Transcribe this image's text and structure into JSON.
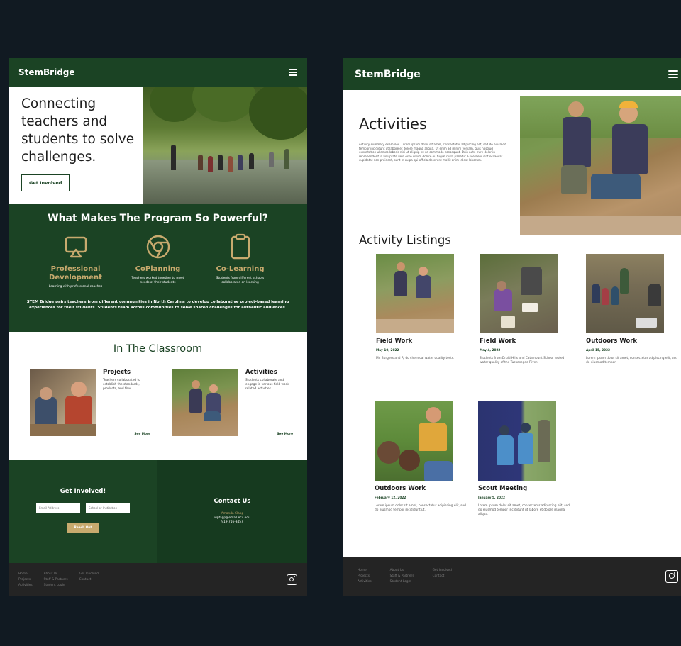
{
  "brand": "StemBridge",
  "home": {
    "hero_title": "Connecting teachers and students to solve challenges.",
    "hero_button": "Get Involved",
    "program_title": "What Makes The Program So Powerful?",
    "features": [
      {
        "name": "Professional Development",
        "desc": "Learning with professional coaches",
        "icon": "presentation-icon"
      },
      {
        "name": "CoPlanning",
        "desc": "Teachers worked together to meet needs of their students",
        "icon": "chrome-circle-icon"
      },
      {
        "name": "Co-Learning",
        "desc": "Students from different schools collaborated on learning",
        "icon": "clipboard-icon"
      }
    ],
    "program_paragraph": "STEM Bridge pairs teachers from different communities in North Carolina to develop collaborative project-based learning experiences for their students. Students team across communities to solve shared challenges for authentic audiences.",
    "classroom_title": "In The Classroom",
    "cards": [
      {
        "title": "Projects",
        "desc": "Teachers collaborated to establish the standards, products, and flow.",
        "more": "See More"
      },
      {
        "title": "Activities",
        "desc": "Students collaborate and engage in various field work related activities.",
        "more": "See More"
      }
    ],
    "get_involved": {
      "title": "Get Involved!",
      "email_placeholder": "Email Address",
      "school_placeholder": "School or Institution",
      "button": "Reach Out"
    },
    "contact": {
      "title": "Contact Us",
      "name": "Amanda Clapp",
      "email": "wpfapp@email.ecu.edu",
      "phone": "919-716-3457"
    }
  },
  "footer": {
    "col1": [
      "Home",
      "Projects",
      "Activities"
    ],
    "col2": [
      "About Us",
      "Staff & Partners",
      "Student Login"
    ],
    "col3": [
      "Get Involved",
      "Contact"
    ]
  },
  "activities": {
    "title": "Activities",
    "summary": "Activity summary examples. Lorem ipsum dolor sit amet, consectetur adipiscing elit, sed do eiusmod tempor incididunt ut labore et dolore magna aliqua. Ut enim ad minim veniam, quis nostrud exercitation ullamco laboris nisi ut aliquip ex ea commodo consequat. Duis aute irure dolor in reprehenderit in voluptate velit esse cillum dolore eu fugiat nulla pariatur. Excepteur sint occaecat cupidatat non proident, sunt in culpa qui officia deserunt mollit anim id est laborum.",
    "listings_title": "Activity Listings",
    "items": [
      {
        "title": "Field Work",
        "date": "May 10, 2022",
        "desc": "Mr. Burgess and RJ do chemical water quality tests."
      },
      {
        "title": "Field Work",
        "date": "May 4, 2022",
        "desc": "Students from Druid Hills and Catamount School tested water quality of the Tuckasegee River."
      },
      {
        "title": "Outdoors Work",
        "date": "April 15, 2022",
        "desc": "Lorem ipsum dolor sit amet, consectetur adipiscing elit, sed do eiusmod tempor"
      },
      {
        "title": "Outdoors Work",
        "date": "February 12, 2022",
        "desc": "Lorem ipsum dolor sit amet, consectetur adipiscing elit, sed do eiusmod tempor incididunt ut."
      },
      {
        "title": "Scout Meeting",
        "date": "January 5, 2022",
        "desc": "Lorem ipsum dolor sit amet, consectetur adipiscing elit, sed do eiusmod tempor incididunt ut labore et dolore magna aliqua."
      }
    ]
  }
}
